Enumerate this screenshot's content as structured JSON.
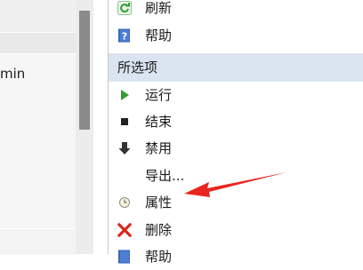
{
  "left_pane": {
    "row_text": "min"
  },
  "actions": {
    "top_items": [
      {
        "label": "刷新",
        "icon": "refresh-icon"
      },
      {
        "label": "帮助",
        "icon": "help-icon"
      }
    ],
    "section_title": "所选项",
    "section_items": [
      {
        "label": "运行",
        "icon": "play-icon"
      },
      {
        "label": "结束",
        "icon": "stop-icon"
      },
      {
        "label": "禁用",
        "icon": "disable-arrow-icon"
      },
      {
        "label": "导出...",
        "icon": ""
      },
      {
        "label": "属性",
        "icon": "properties-icon"
      },
      {
        "label": "删除",
        "icon": "delete-x-icon"
      },
      {
        "label": "帮助",
        "icon": "help-icon"
      }
    ]
  },
  "colors": {
    "section_header_bg": "#dbe5f1",
    "arrow": "#e8261f",
    "play": "#2e9f2e",
    "delete": "#d9261c",
    "help": "#2f5fb3"
  }
}
